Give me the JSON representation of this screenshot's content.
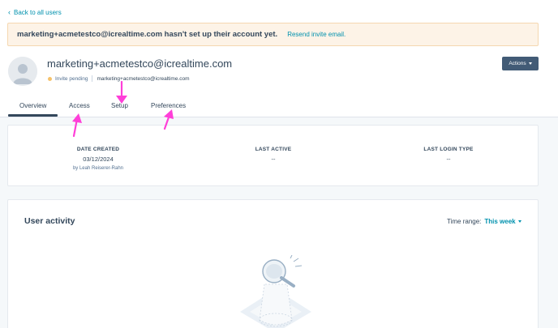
{
  "back_link": {
    "label": "Back to all users"
  },
  "banner": {
    "message": "marketing+acmetestco@icrealtime.com hasn't set up their account yet.",
    "action": "Resend invite email."
  },
  "user": {
    "email": "marketing+acmetestco@icrealtime.com",
    "status": "Invite pending",
    "status_email": "marketing+acmetestco@icrealtime.com"
  },
  "actions": {
    "label": "Actions"
  },
  "tabs": [
    {
      "label": "Overview",
      "active": true
    },
    {
      "label": "Access"
    },
    {
      "label": "Setup"
    },
    {
      "label": "Preferences"
    }
  ],
  "stats": {
    "date_created": {
      "label": "DATE CREATED",
      "value": "03/12/2024",
      "sub": "by Leah Reiserer-Rahn"
    },
    "last_active": {
      "label": "LAST ACTIVE",
      "value": "--"
    },
    "last_login_type": {
      "label": "LAST LOGIN TYPE",
      "value": "--"
    }
  },
  "activity": {
    "title": "User activity",
    "range_label": "Time range:",
    "range_value": "This week"
  },
  "colors": {
    "accent": "#0091ae",
    "dark_button": "#425b76",
    "banner_bg": "#fdf3e7",
    "pending_dot": "#f5c26b",
    "annotation_arrow": "#ff3fd8"
  },
  "icons": [
    "chevron-left-icon",
    "avatar-placeholder-icon",
    "caret-down-icon",
    "magnifier-empty-state-illustration",
    "annotation-arrow"
  ]
}
